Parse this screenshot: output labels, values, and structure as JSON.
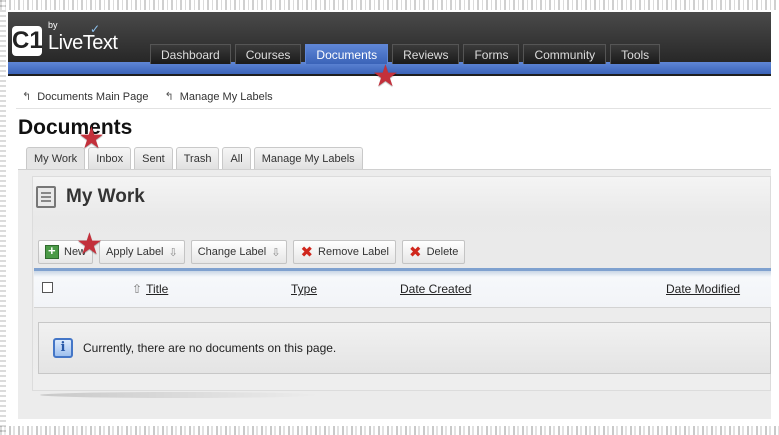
{
  "logo": {
    "by": "by",
    "brand_c1": "C1",
    "brand_text": "LiveText"
  },
  "nav": {
    "tabs": [
      {
        "label": "Dashboard",
        "active": false
      },
      {
        "label": "Courses",
        "active": false
      },
      {
        "label": "Documents",
        "active": true
      },
      {
        "label": "Reviews",
        "active": false
      },
      {
        "label": "Forms",
        "active": false
      },
      {
        "label": "Community",
        "active": false
      },
      {
        "label": "Tools",
        "active": false
      }
    ]
  },
  "breadcrumb": [
    {
      "label": "Documents Main Page"
    },
    {
      "label": "Manage My Labels"
    }
  ],
  "page_title": "Documents",
  "tabs": [
    {
      "label": "My Work",
      "active": true
    },
    {
      "label": "Inbox",
      "active": false
    },
    {
      "label": "Sent",
      "active": false
    },
    {
      "label": "Trash",
      "active": false
    },
    {
      "label": "All",
      "active": false
    },
    {
      "label": "Manage My Labels",
      "active": false
    }
  ],
  "section_title": "My Work",
  "toolbar": {
    "new_label": "New",
    "apply_label": "Apply Label",
    "change_label": "Change Label",
    "remove_label": "Remove Label",
    "delete_label": "Delete"
  },
  "table": {
    "columns": {
      "title": "Title",
      "type": "Type",
      "date_created": "Date Created",
      "date_modified": "Date Modified"
    }
  },
  "empty_message": "Currently, there are no documents on this page.",
  "colors": {
    "accent_blue": "#3a63b8",
    "star_red": "#c3303b",
    "delete_red": "#d0271d"
  }
}
